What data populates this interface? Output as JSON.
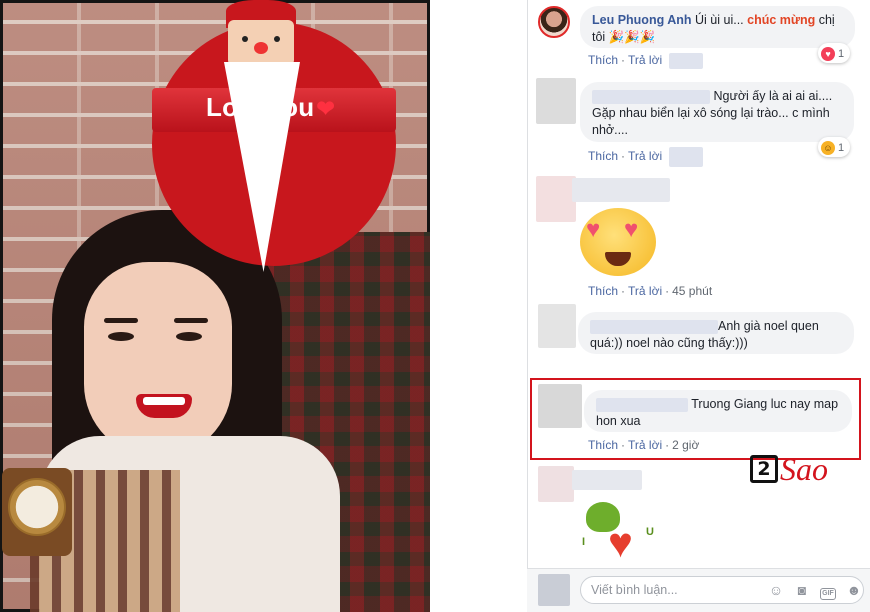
{
  "photo": {
    "sticker_text": "Loveyou",
    "sticker_heart": "❤"
  },
  "comments": [
    {
      "author": "Leu Phuong Anh",
      "text_before": "Úi ùi ui...",
      "text_highlight": "chúc mừng",
      "text_after": "chị tôi",
      "party_emoji": "🎉🎉🎉",
      "actions": {
        "like": "Thích",
        "reply": "Trả lời"
      },
      "reaction": {
        "icon": "love-icon",
        "count": "1"
      }
    },
    {
      "line1": "Người ấy là ai ai ai....",
      "line2": "Gặp nhau biển lại xô sóng lại trào... c mình",
      "line3": "nhở....",
      "actions": {
        "like": "Thích",
        "reply": "Trả lời"
      },
      "reaction": {
        "icon": "haha-icon",
        "count": "1"
      }
    },
    {
      "emoji": "heart-eyes-emoji",
      "actions": {
        "like": "Thích",
        "reply": "Trả lời",
        "time": "45 phút"
      }
    },
    {
      "line1": "Anh già noel quen",
      "line2": "quá:)) noel nào cũng thấy:)))"
    },
    {
      "line1": "Truong Giang luc nay map",
      "line2": "hon xua",
      "actions": {
        "like": "Thích",
        "reply": "Trả lời",
        "time": "2 giờ"
      }
    },
    {
      "sticker": "i-love-u-sticker",
      "sticker_i": "I",
      "sticker_u": "U"
    }
  ],
  "watermark": {
    "number": "2",
    "text": "Sao"
  },
  "composer": {
    "placeholder": "Viết bình luận...",
    "icons": [
      "emoji-icon",
      "camera-icon",
      "gif-icon",
      "sticker-icon"
    ],
    "gif_label": "GIF"
  },
  "colors": {
    "link": "#4b67a1",
    "author": "#385898",
    "highlight_border": "#d3141d",
    "sticker_red": "#c8171d"
  }
}
